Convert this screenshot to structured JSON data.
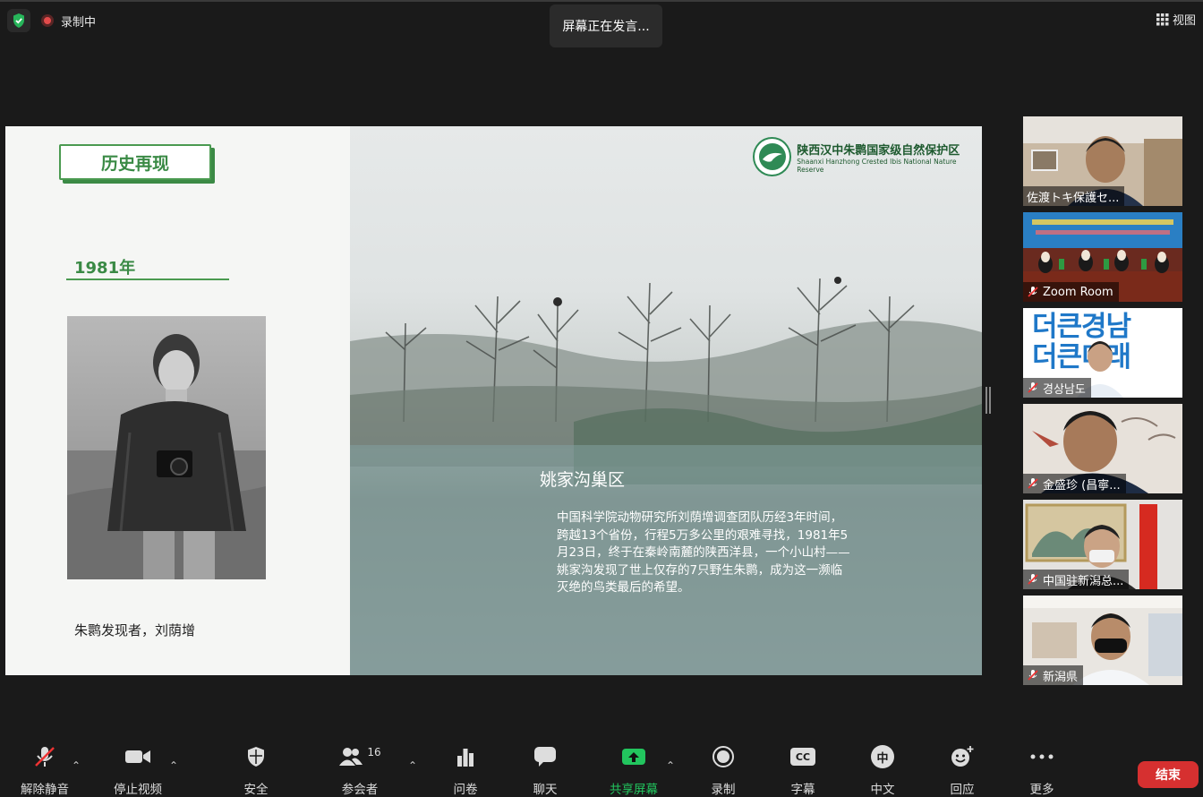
{
  "top_bar": {
    "recording_label": "录制中",
    "speaking_label": "屏幕正在发言...",
    "view_label": "视图"
  },
  "slide": {
    "section_title": "历史再现",
    "year": "1981年",
    "portrait_caption": "朱鹮发现者，刘荫增",
    "logo_cn": "陕西汉中朱鹮国家级自然保护区",
    "logo_en": "Shaanxi Hanzhong Crested Ibis National Nature Reserve",
    "nest_title": "姚家沟巢区",
    "nest_text": "中国科学院动物研究所刘荫增调查团队历经3年时间，跨越13个省份，行程5万多公里的艰难寻找，1981年5月23日，终于在秦岭南麓的陕西洋县，一个小山村——姚家沟发现了世上仅存的7只野生朱鹮，成为这一濒临灭绝的鸟类最后的希望。"
  },
  "participants": [
    {
      "name": "佐渡トキ保護セ...",
      "muted": false
    },
    {
      "name": "Zoom Room",
      "muted": true
    },
    {
      "name": "경상남도",
      "muted": true
    },
    {
      "name": "金盛珍 (昌寧...",
      "muted": true
    },
    {
      "name": "中国驻新潟总...",
      "muted": true
    },
    {
      "name": "新潟県",
      "muted": true
    }
  ],
  "thumb_texts": {
    "gyeongnam_line1": "더큰경남",
    "gyeongnam_line2": "더큰미래"
  },
  "toolbar": {
    "unmute": "解除静音",
    "stop_video": "停止视频",
    "security": "安全",
    "participants": "参会者",
    "participants_count": "16",
    "polls": "问卷",
    "chat": "聊天",
    "share_screen": "共享屏幕",
    "record": "录制",
    "captions": "字幕",
    "cc_icon_text": "CC",
    "language": "中文",
    "language_icon_text": "中",
    "reactions": "回应",
    "more": "更多",
    "end": "结束"
  },
  "colors": {
    "accent_green": "#3a8a45",
    "share_green": "#22c55e",
    "end_red": "#d63030"
  }
}
